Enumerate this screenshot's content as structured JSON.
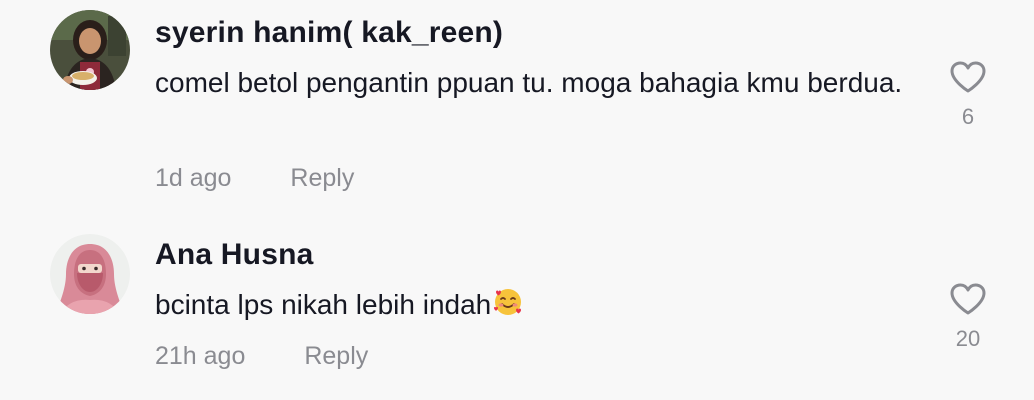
{
  "comments": [
    {
      "username": "syerin hanim( kak_reen)",
      "text": "comel betol pengantin ppuan tu. moga bahagia kmu berdua.",
      "time": "1d ago",
      "reply_label": "Reply",
      "like_count": "6",
      "avatar_icon": "user-photo-avatar"
    },
    {
      "username": "Ana Husna",
      "text": "bcinta lps nikah lebih indah",
      "emoji": "smiling-face-with-hearts",
      "time": "21h ago",
      "reply_label": "Reply",
      "like_count": "20",
      "avatar_icon": "hijab-illustration-avatar"
    }
  ],
  "colors": {
    "background": "#f8f8f8",
    "primary_text": "#161823",
    "secondary_text": "#8a8b91"
  }
}
